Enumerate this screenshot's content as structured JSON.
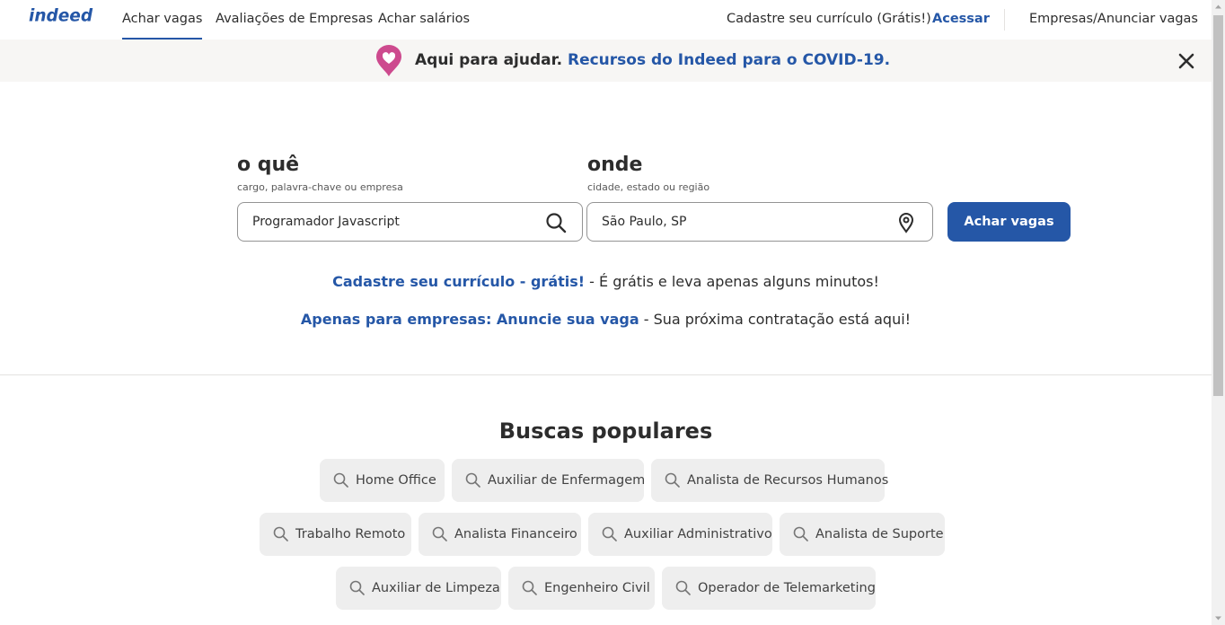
{
  "header": {
    "logo_text": "indeed",
    "nav": [
      "Achar vagas",
      "Avaliações de Empresas",
      "Achar salários"
    ],
    "register_label": "Cadastre seu currículo (Grátis!)",
    "signin_label": "Acessar",
    "employers_label": "Empresas/Anunciar vagas"
  },
  "banner": {
    "lead": "Aqui para ajudar.",
    "link": "Recursos do Indeed para o COVID-19."
  },
  "search": {
    "what_label": "o quê",
    "what_hint": "cargo, palavra-chave ou empresa",
    "what_value": "Programador Javascript",
    "where_label": "onde",
    "where_hint": "cidade, estado ou região",
    "where_value": "São Paulo, SP",
    "button_label": "Achar vagas"
  },
  "promo": {
    "resume_link": "Cadastre seu currículo - grátis!",
    "resume_text": " - É grátis e leva apenas alguns minutos!",
    "employer_link": "Apenas para empresas: Anuncie sua vaga",
    "employer_text": " - Sua próxima contratação está aqui!"
  },
  "popular": {
    "title": "Buscas populares",
    "items": [
      "Home Office",
      "Auxiliar de Enfermagem",
      "Analista de Recursos Humanos",
      "Trabalho Remoto",
      "Analista Financeiro",
      "Auxiliar Administrativo",
      "Analista de Suporte",
      "Auxiliar de Limpeza",
      "Engenheiro Civil",
      "Operador de Telemarketing"
    ]
  },
  "colors": {
    "brand_blue": "#2557a7",
    "banner_bg": "#f7f6f4",
    "chip_bg": "#eeeeee"
  }
}
